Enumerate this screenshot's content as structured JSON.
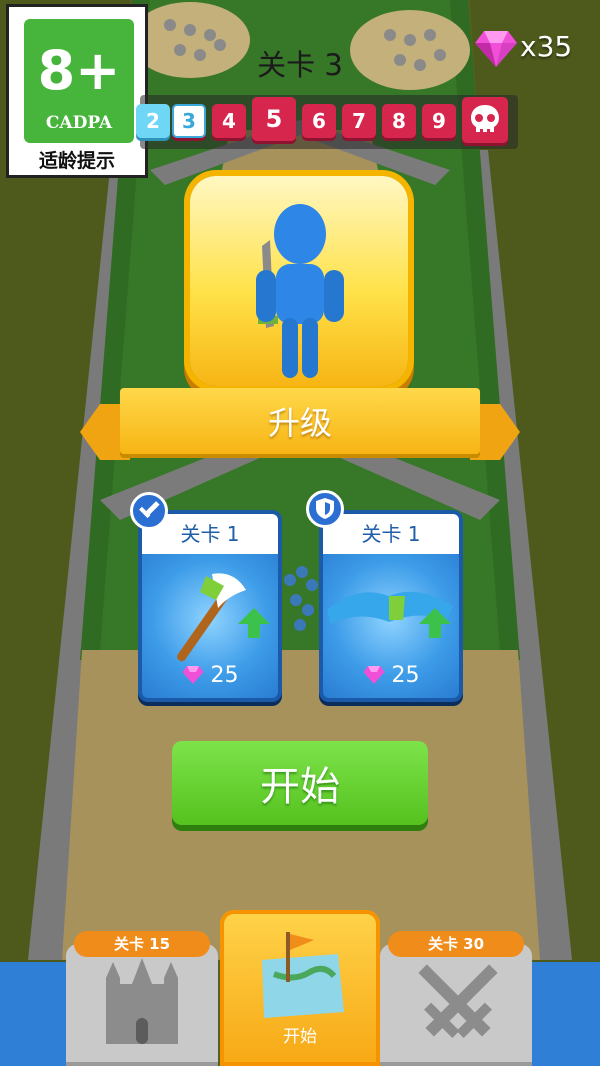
{
  "age_rating": {
    "age": "8+",
    "org": "CADPA",
    "note": "适龄提示"
  },
  "header": {
    "level_title": "关卡 3",
    "gems": "x35"
  },
  "stage_bar": {
    "stages": [
      {
        "label": "2",
        "state": "done"
      },
      {
        "label": "3",
        "state": "current"
      },
      {
        "label": "4",
        "state": "upcoming"
      },
      {
        "label": "5",
        "state": "milestone"
      },
      {
        "label": "6",
        "state": "upcoming"
      },
      {
        "label": "7",
        "state": "upcoming"
      },
      {
        "label": "8",
        "state": "upcoming"
      },
      {
        "label": "9",
        "state": "upcoming"
      }
    ],
    "boss_icon": "skull-icon"
  },
  "upgrade_banner": {
    "label": "升级"
  },
  "upgrades": [
    {
      "type": "weapon",
      "badge_icon": "sword-icon",
      "level": "关卡 1",
      "item_icon": "axe-icon",
      "cost": "25"
    },
    {
      "type": "armor",
      "badge_icon": "shield-icon",
      "level": "关卡 1",
      "item_icon": "armor-icon",
      "cost": "25"
    }
  ],
  "start_button": {
    "label": "开始"
  },
  "bottom_nav": {
    "left": {
      "tag": "关卡 15",
      "icon": "castle-icon"
    },
    "center": {
      "label": "开始",
      "icon": "map-flag-icon"
    },
    "right": {
      "tag": "关卡 30",
      "icon": "crossed-swords-icon"
    }
  },
  "colors": {
    "gem": "#f04fd8",
    "accent": "#f5b400",
    "start": "#5ccc26",
    "stage": "#d7264d"
  }
}
